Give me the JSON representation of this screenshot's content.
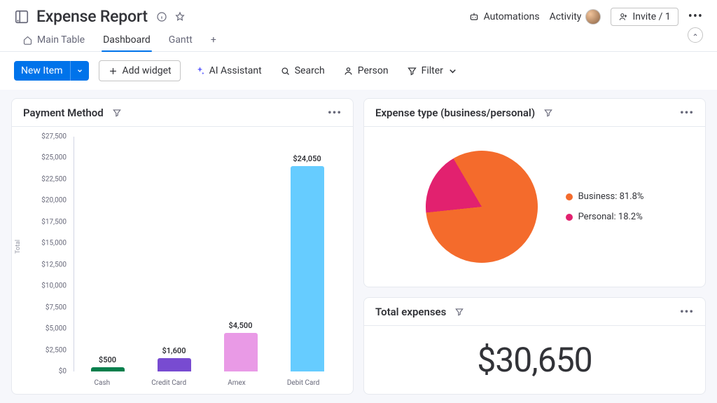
{
  "header": {
    "title": "Expense Report",
    "info_icon": "info-icon",
    "star_icon": "star-icon",
    "automations_label": "Automations",
    "activity_label": "Activity",
    "invite_label": "Invite / 1"
  },
  "tabs": {
    "items": [
      {
        "label": "Main Table",
        "active": false
      },
      {
        "label": "Dashboard",
        "active": true
      },
      {
        "label": "Gantt",
        "active": false
      }
    ],
    "add_label": "+"
  },
  "toolbar": {
    "new_item_label": "New Item",
    "add_widget_label": "Add widget",
    "ai_label": "AI Assistant",
    "search_label": "Search",
    "person_label": "Person",
    "filter_label": "Filter"
  },
  "widgets": {
    "payment_method": {
      "title": "Payment Method",
      "yaxis_label": "Total"
    },
    "expense_type": {
      "title": "Expense type (business/personal)"
    },
    "total_expenses": {
      "title": "Total expenses",
      "value": "$30,650"
    }
  },
  "chart_data": [
    {
      "id": "payment_method",
      "type": "bar",
      "ylabel": "Total",
      "ylim": [
        0,
        27500
      ],
      "yticks": [
        "$0",
        "$2,500",
        "$5,000",
        "$7,500",
        "$10,000",
        "$12,500",
        "$15,000",
        "$17,500",
        "$20,000",
        "$22,500",
        "$25,000",
        "$27,500"
      ],
      "categories": [
        "Cash",
        "Credit Card",
        "Amex",
        "Debit Card"
      ],
      "values": [
        500,
        1600,
        4500,
        24050
      ],
      "value_labels": [
        "$500",
        "$1,600",
        "$4,500",
        "$24,050"
      ],
      "colors": [
        "#037f4c",
        "#784bd1",
        "#e99ae6",
        "#66ccff"
      ]
    },
    {
      "id": "expense_type",
      "type": "pie",
      "series": [
        {
          "name": "Business",
          "pct": 81.8,
          "label": "Business: 81.8%",
          "color": "#f46b2c"
        },
        {
          "name": "Personal",
          "pct": 18.2,
          "label": "Personal: 18.2%",
          "color": "#e2216f"
        }
      ]
    }
  ]
}
